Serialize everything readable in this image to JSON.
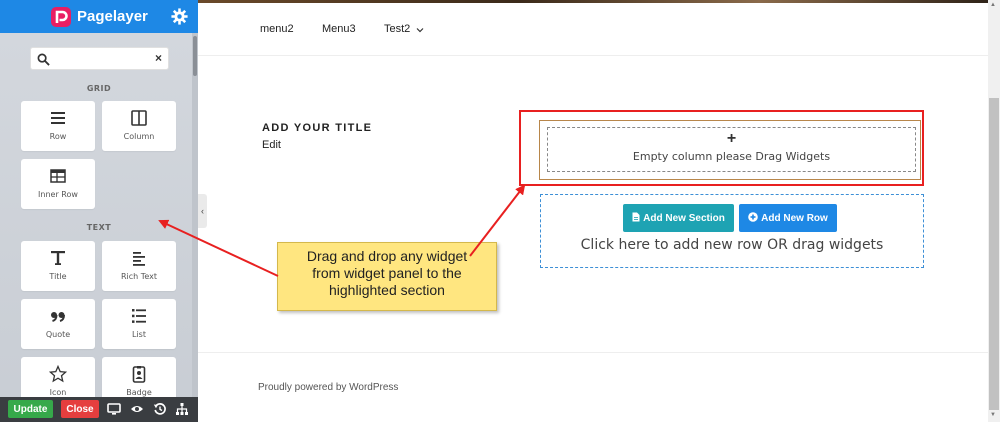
{
  "panel": {
    "brand": "Pagelayer",
    "search": {
      "value": "",
      "placeholder": ""
    },
    "categories": {
      "grid": "GRID",
      "text": "TEXT"
    },
    "widgets": [
      {
        "label": "Row",
        "icon": "rows-icon"
      },
      {
        "label": "Column",
        "icon": "columns-icon"
      },
      {
        "label": "Inner Row",
        "icon": "inner-row-icon"
      },
      {
        "label": "Title",
        "icon": "title-icon"
      },
      {
        "label": "Rich Text",
        "icon": "rich-text-icon"
      },
      {
        "label": "Quote",
        "icon": "quote-icon"
      },
      {
        "label": "List",
        "icon": "list-icon"
      },
      {
        "label": "Icon",
        "icon": "star-icon"
      },
      {
        "label": "Badge",
        "icon": "badge-icon"
      }
    ],
    "update_label": "Update",
    "close_label": "Close",
    "colors": {
      "header": "#1e88e5",
      "update": "#36a94a",
      "close": "#e53e3e",
      "logo": "#e91e63"
    }
  },
  "site": {
    "nav": [
      "menu2",
      "Menu3",
      "Test2"
    ],
    "title": "ADD YOUR TITLE",
    "title_sub": "Edit",
    "empty_column_plus": "+",
    "empty_column_text": "Empty column please Drag Widgets",
    "add_section_label": "Add New Section",
    "add_row_label": "Add New Row",
    "drop_text": "Click here to add new row OR drag widgets",
    "footer": "Proudly powered by WordPress"
  },
  "callout": {
    "lines": [
      "Drag and drop any widget",
      "from widget panel to the",
      "highlighted section"
    ]
  }
}
